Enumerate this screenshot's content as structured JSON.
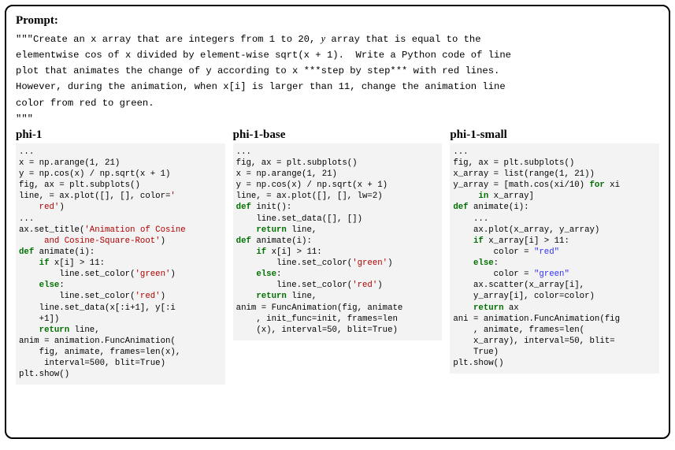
{
  "prompt": {
    "title": "Prompt:",
    "line1": "\"\"\"Create an x array that are integers from 1 to 20, ",
    "y_var": "y",
    "line1b": " array that is equal to the",
    "line2": "elementwise cos of x divided by element-wise sqrt(x + 1).  Write a Python code of line",
    "line3": "plot that animates the change of y according to x ***step by step*** with red lines.",
    "line4": "However, during the animation, when x[i] is larger than 11, change the animation line",
    "line5": "color from red to green.",
    "line6": "\"\"\""
  },
  "columns": [
    {
      "title": "phi-1",
      "code": "...\nx = np.arange(1, 21)\ny = np.cos(x) / np.sqrt(x + 1)\nfig, ax = plt.subplots()\nline, = ax.plot([], [], color=<span class=\"str-r\">'\n    red'</span>)\n...\nax.set_title(<span class=\"str-r\">'Animation of Cosine\n     and Cosine-Square-Root'</span>)\n<span class=\"kw\">def</span> animate(i):\n    <span class=\"kw\">if</span> x[i] > 11:\n        line.set_color(<span class=\"str-r\">'green'</span>)\n    <span class=\"kw\">else</span>:\n        line.set_color(<span class=\"str-r\">'red'</span>)\n    line.set_data(x[:i+1], y[:i\n    +1])\n    <span class=\"kw\">return</span> line,\nanim = animation.FuncAnimation(\n    fig, animate, frames=len(x),\n     interval=500, blit=True)\nplt.show()"
    },
    {
      "title": "phi-1-base",
      "code": "...\nfig, ax = plt.subplots()\nx = np.arange(1, 21)\ny = np.cos(x) / np.sqrt(x + 1)\nline, = ax.plot([], [], lw=2)\n<span class=\"kw\">def</span> init():\n    line.set_data([], [])\n    <span class=\"kw\">return</span> line,\n<span class=\"kw\">def</span> animate(i):\n    <span class=\"kw\">if</span> x[i] > 11:\n        line.set_color(<span class=\"str-r\">'green'</span>)\n    <span class=\"kw\">else</span>:\n        line.set_color(<span class=\"str-r\">'red'</span>)\n    <span class=\"kw\">return</span> line,\nanim = FuncAnimation(fig, animate\n    , init_func=init, frames=len\n    (x), interval=50, blit=True)"
    },
    {
      "title": "phi-1-small",
      "code": "...\nfig, ax = plt.subplots()\nx_array = list(range(1, 21))\ny_array = [math.cos(xi/10) <span class=\"kw\">for</span> xi\n     <span class=\"kw\">in</span> x_array]\n<span class=\"kw\">def</span> animate(i):\n    ...\n    ax.plot(x_array, y_array)\n    <span class=\"kw\">if</span> x_array[i] > 11:\n        color = <span class=\"str-b\">\"red\"</span>\n    <span class=\"kw\">else</span>:\n        color = <span class=\"str-b\">\"green\"</span>\n    ax.scatter(x_array[i],\n    y_array[i], color=color)\n    <span class=\"kw\">return</span> ax\nani = animation.FuncAnimation(fig\n    , animate, frames=len(\n    x_array), interval=50, blit=\n    True)\nplt.show()"
    }
  ]
}
